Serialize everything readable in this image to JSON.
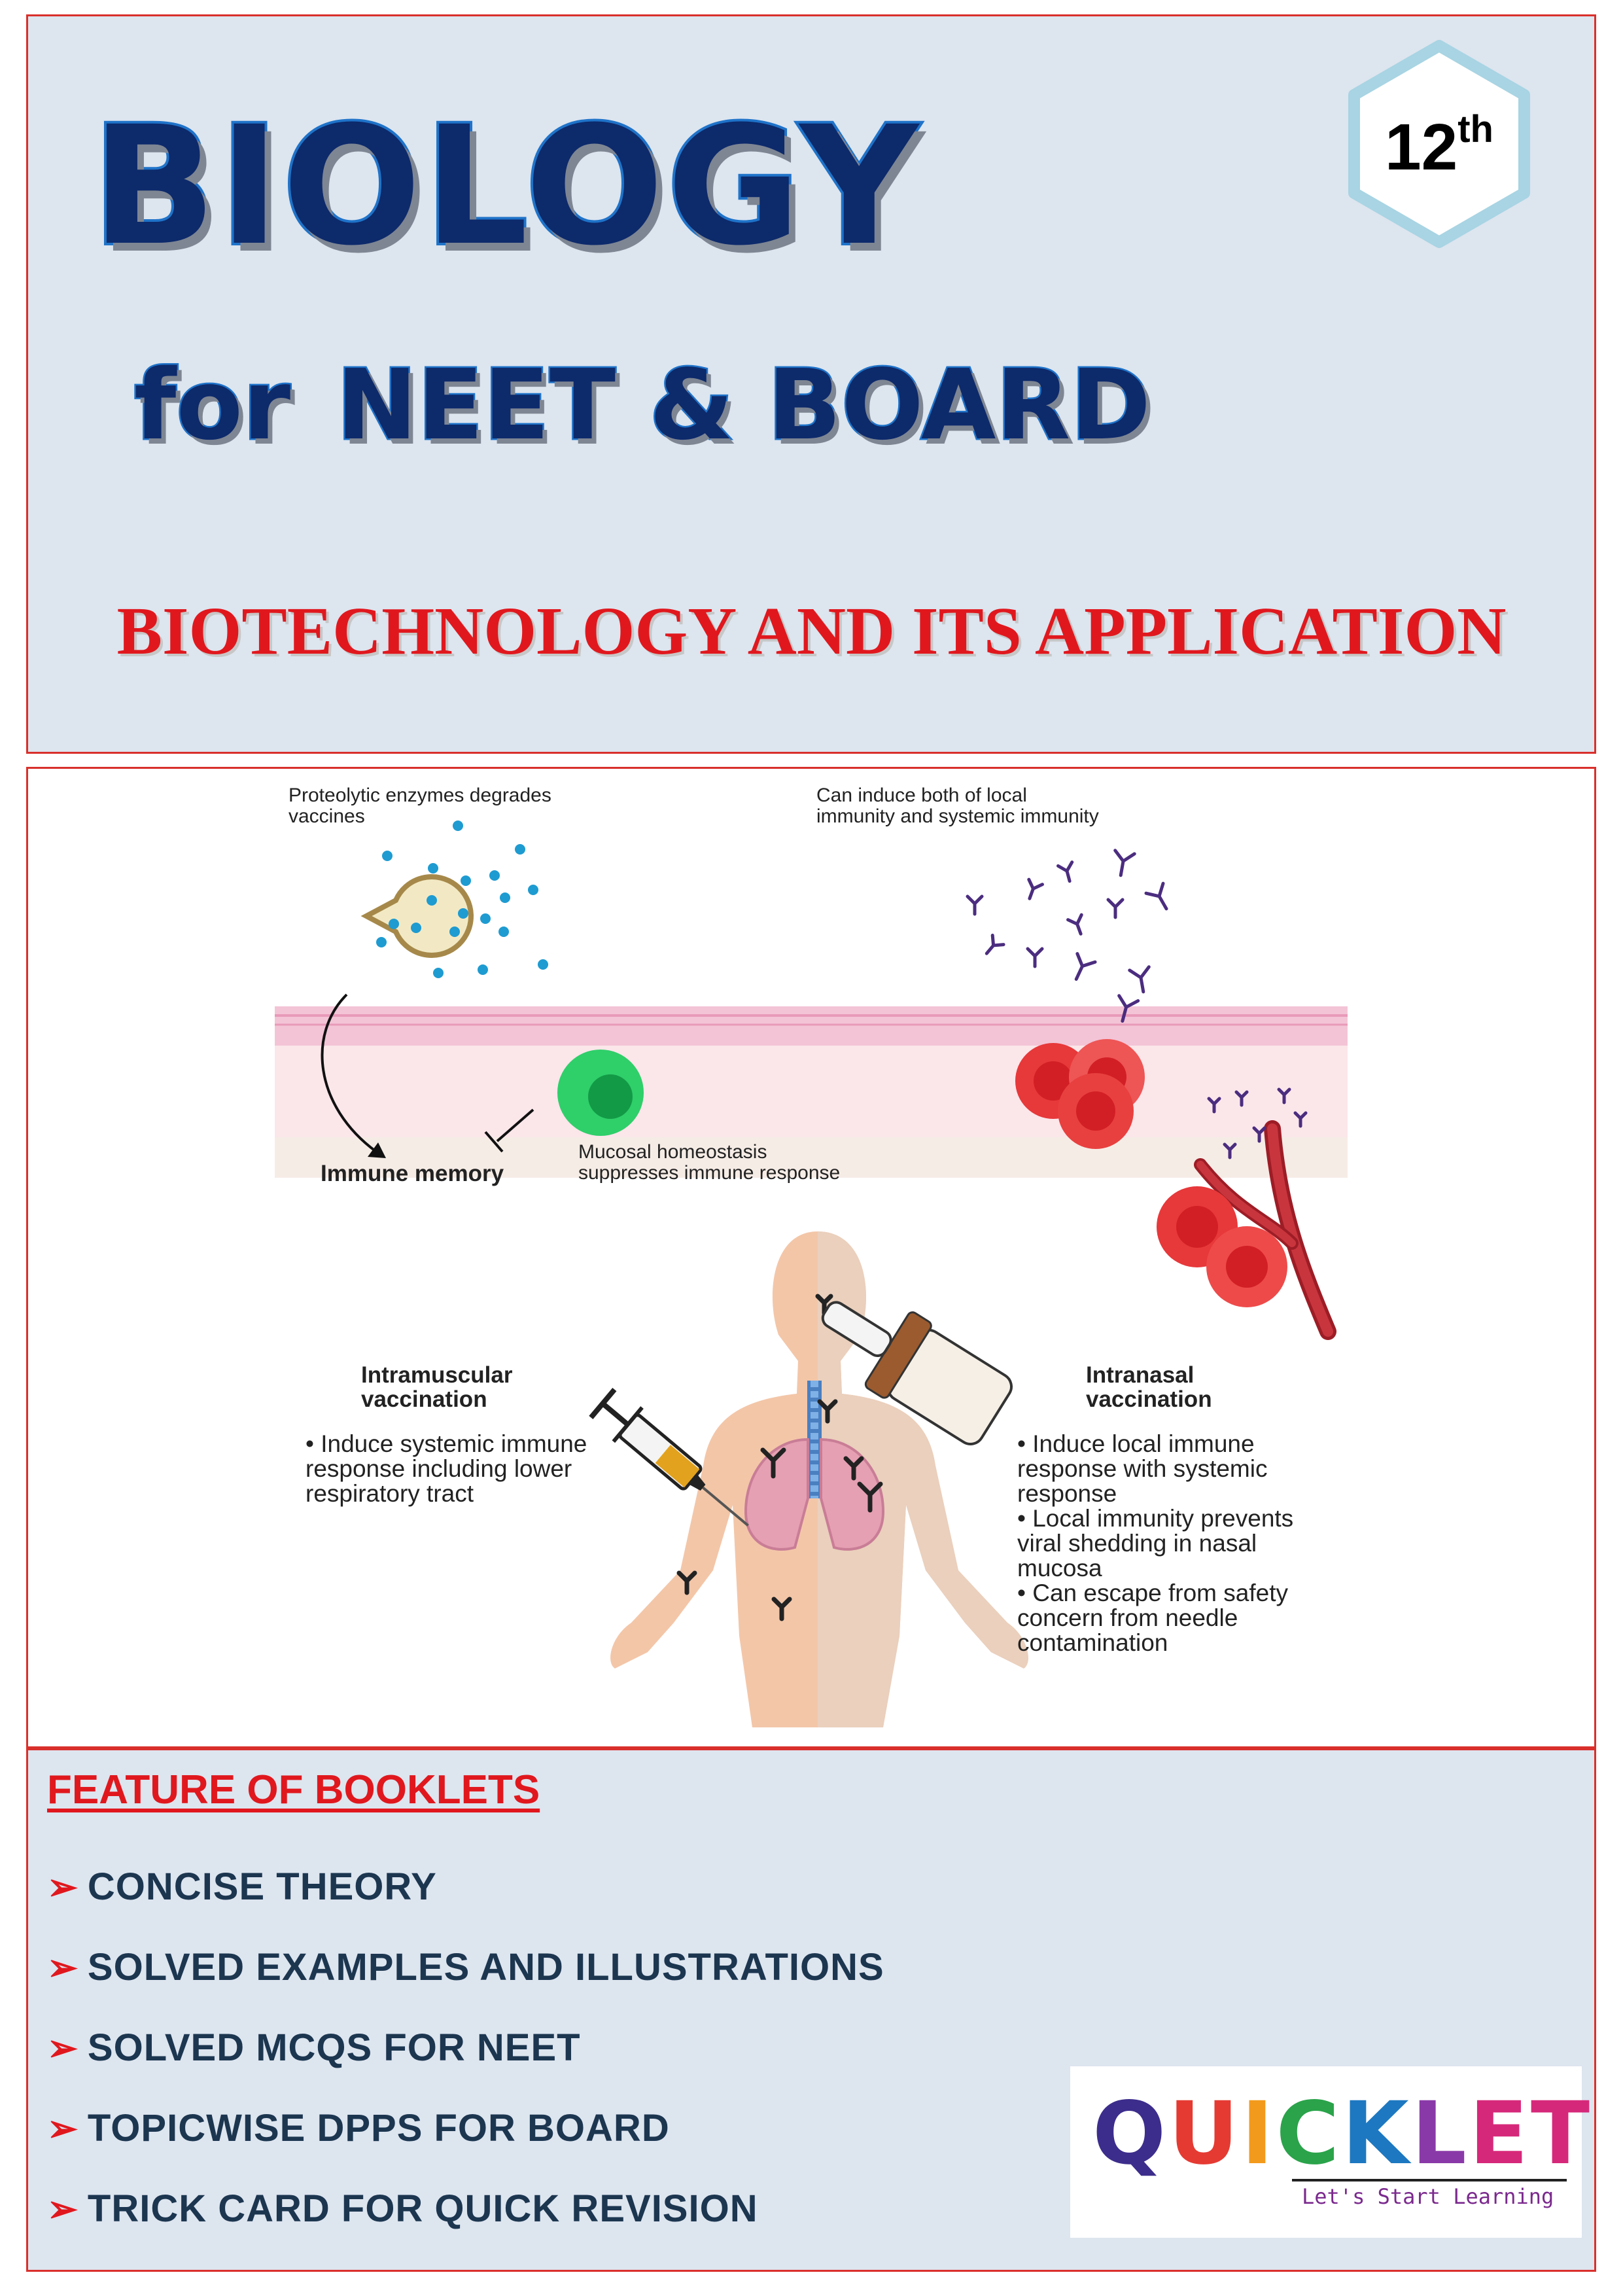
{
  "header": {
    "title": "BIOLOGY",
    "subtitle_for": "for",
    "subtitle_rest": "NEET & BOARD",
    "chapter": "BIOTECHNOLOGY AND ITS APPLICATION",
    "grade_number": "12",
    "grade_suffix": "th"
  },
  "diagram": {
    "caption_proteolytic": [
      "Proteolytic enzymes degrades",
      "vaccines"
    ],
    "caption_induce_both": [
      "Can induce both of local",
      "immunity and systemic immunity"
    ],
    "label_immune_memory": "Immune memory",
    "caption_mucosal": [
      "Mucosal homeostasis",
      "suppresses immune response"
    ],
    "intramuscular_title": [
      "Intramuscular",
      "vaccination"
    ],
    "intramuscular_bullets": [
      "Induce systemic immune",
      "response including lower",
      "respiratory tract"
    ],
    "intranasal_title": [
      "Intranasal",
      "vaccination"
    ],
    "intranasal_bullets": [
      "Induce local immune",
      "response with systemic",
      "response",
      "Local immunity prevents",
      "viral shedding in nasal",
      "mucosa",
      "Can escape from safety",
      "concern from needle",
      "contamination"
    ]
  },
  "features": {
    "heading": "FEATURE OF BOOKLETS",
    "items": [
      "CONCISE THEORY",
      "SOLVED EXAMPLES AND ILLUSTRATIONS",
      "SOLVED MCQS FOR NEET",
      "TOPICWISE DPPS FOR BOARD",
      "TRICK CARD FOR QUICK REVISION"
    ]
  },
  "logo": {
    "letters": [
      "Q",
      "U",
      "I",
      "C",
      "K",
      "L",
      "ET"
    ],
    "tagline": "Let's Start Learning"
  },
  "colors": {
    "panel_border": "#d9302c",
    "panel_fill": "#dde5ef",
    "title_blue": "#0d2a6b",
    "accent_red": "#e0181e",
    "feature_text": "#1c3650"
  }
}
